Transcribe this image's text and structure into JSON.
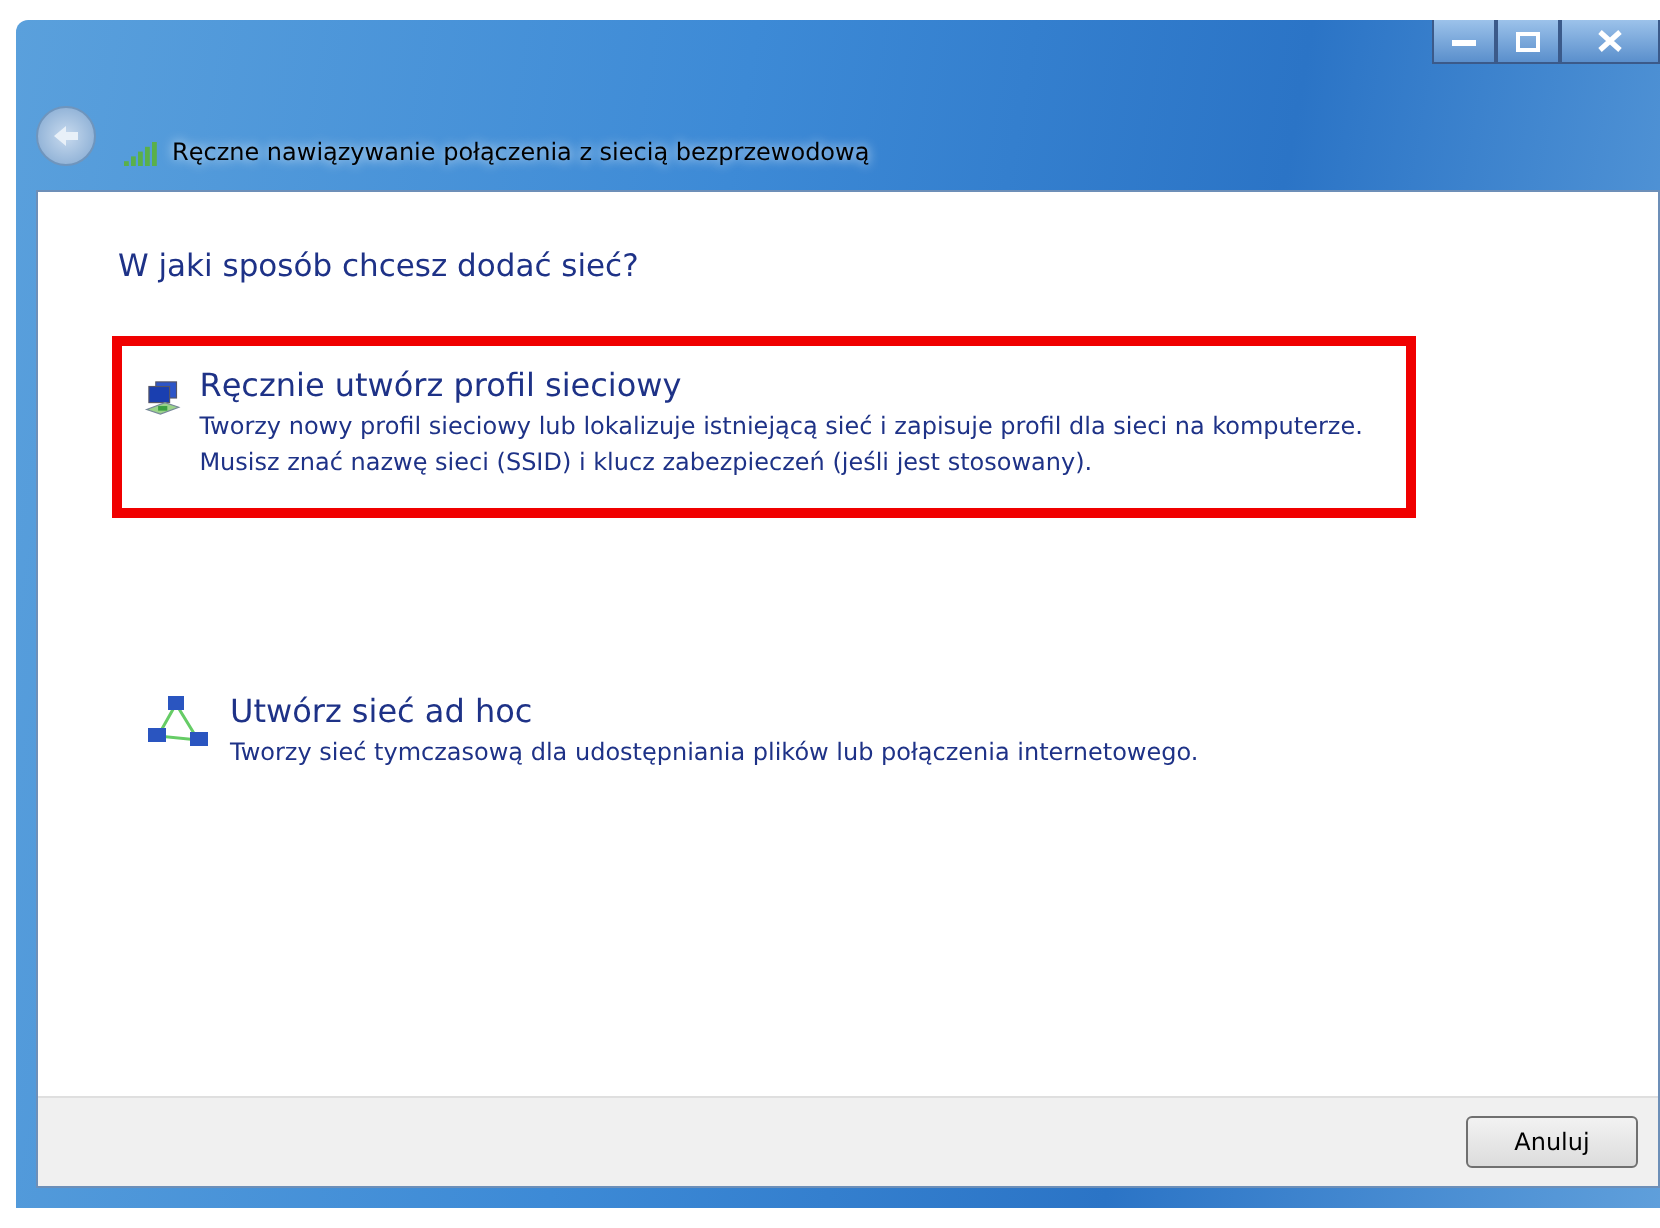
{
  "window": {
    "title": "Ręczne nawiązywanie połączenia z siecią bezprzewodową"
  },
  "heading": "W jaki sposób chcesz dodać sieć?",
  "options": [
    {
      "kind": "profile",
      "title": "Ręcznie utwórz profil sieciowy",
      "description": "Tworzy nowy profil sieciowy lub lokalizuje istniejącą sieć i zapisuje profil dla sieci na komputerze. Musisz znać nazwę sieci (SSID) i klucz zabezpieczeń (jeśli jest stosowany).",
      "highlighted": true
    },
    {
      "kind": "adhoc",
      "title": "Utwórz sieć ad hoc",
      "description": "Tworzy sieć tymczasową dla  udostępniania plików lub połączenia internetowego.",
      "highlighted": false
    }
  ],
  "buttons": [
    "Anuluj"
  ]
}
